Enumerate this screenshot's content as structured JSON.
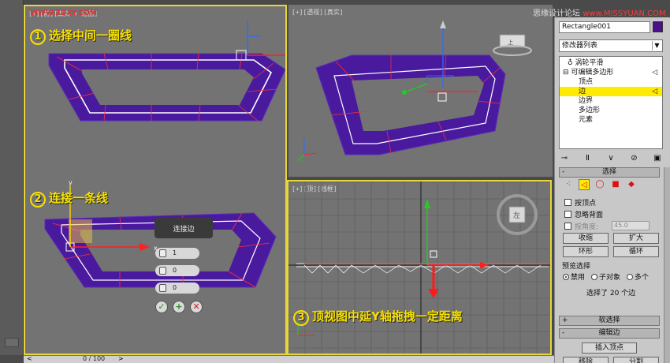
{
  "watermark": "WWW.3DXY.COM",
  "top_right_watermark": {
    "prefix": "思缘设计论坛 ",
    "site": "www.MISSYUAN.COM"
  },
  "viewports": {
    "left": {
      "label": "[+][前][真实 + 边面]"
    },
    "perspective": {
      "label": "[+][透视][真实]"
    },
    "top": {
      "label": "[+][顶][线框]"
    }
  },
  "steps": {
    "step1": {
      "num": "1",
      "text": "选择中间一圈线"
    },
    "step2": {
      "num": "2",
      "text": "连接一条线"
    },
    "step3": {
      "num": "3",
      "text": "顶视图中延Y轴拖拽一定距离"
    }
  },
  "connect_dialog": {
    "title": "连接边",
    "segments": "1",
    "pinch": "0",
    "slide": "0",
    "ok": "✓",
    "apply": "+",
    "cancel": "✕"
  },
  "axis_labels": {
    "x": "x",
    "y": "y",
    "z": "z"
  },
  "viewcube": {
    "front": "左",
    "top_face": "上"
  },
  "command_panel": {
    "object_name": "Rectangle001",
    "object_color": "#4b0f8c",
    "modifier_list": "修改器列表",
    "stack": [
      {
        "label": "涡轮平滑",
        "indent": 1
      },
      {
        "label": "可编辑多边形",
        "indent": 0
      },
      {
        "label": "顶点",
        "indent": 2
      },
      {
        "label": "边",
        "indent": 2,
        "selected": true
      },
      {
        "label": "边界",
        "indent": 2
      },
      {
        "label": "多边形",
        "indent": 2
      },
      {
        "label": "元素",
        "indent": 2
      }
    ],
    "selection_rollout": {
      "sign": "-",
      "title": "选择",
      "by_vertex": "按顶点",
      "ignore_backfacing": "忽略背面",
      "by_angle": "按角度:",
      "angle_value": "45.0",
      "shrink": "收缩",
      "grow": "扩大",
      "ring": "环形",
      "loop": "循环",
      "preview_group": "预览选择",
      "disabled": "禁用",
      "subobject": "子对象",
      "multi": "多个",
      "selected_count": "选择了 20 个边"
    },
    "soft_selection": {
      "sign": "+",
      "title": "软选择"
    },
    "edit_edges": {
      "sign": "-",
      "title": "编辑边"
    },
    "insert_vertex": "插入顶点",
    "remove": "移除",
    "split": "分割"
  },
  "timeline": {
    "counter": "0 / 100",
    "prev": "<",
    "next": ">"
  },
  "colors": {
    "accent": "#f7e000",
    "shape_fill": "#4a1a9e",
    "edge": "#ff2222"
  }
}
